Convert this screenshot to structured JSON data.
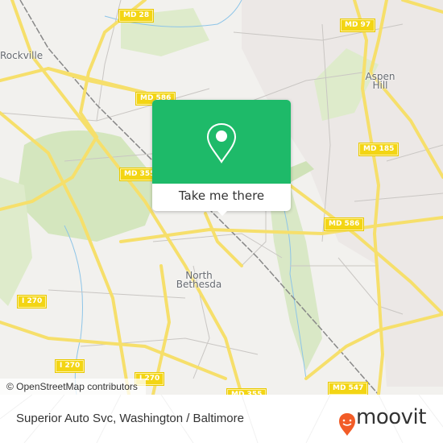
{
  "map": {
    "shields": [
      {
        "label": "MD 28"
      },
      {
        "label": "MD 97"
      },
      {
        "label": "MD 586"
      },
      {
        "label": "MD 185"
      },
      {
        "label": "MD 355"
      },
      {
        "label": "MD 586"
      },
      {
        "label": "I 270"
      },
      {
        "label": "I 270"
      },
      {
        "label": "I 270"
      },
      {
        "label": "MD 355"
      },
      {
        "label": "MD 547"
      }
    ],
    "places": [
      {
        "label": "Rockville"
      },
      {
        "label": "Aspen Hill"
      },
      {
        "label": "North Bethesda"
      }
    ],
    "attribution": "© OpenStreetMap contributors"
  },
  "popup": {
    "icon": "location-pin-icon",
    "button_label": "Take me there",
    "accent_color": "#1eba69"
  },
  "footer": {
    "title": "Superior Auto Svc, Washington / Baltimore",
    "brand": "moovit",
    "brand_color": "#f25c27"
  }
}
